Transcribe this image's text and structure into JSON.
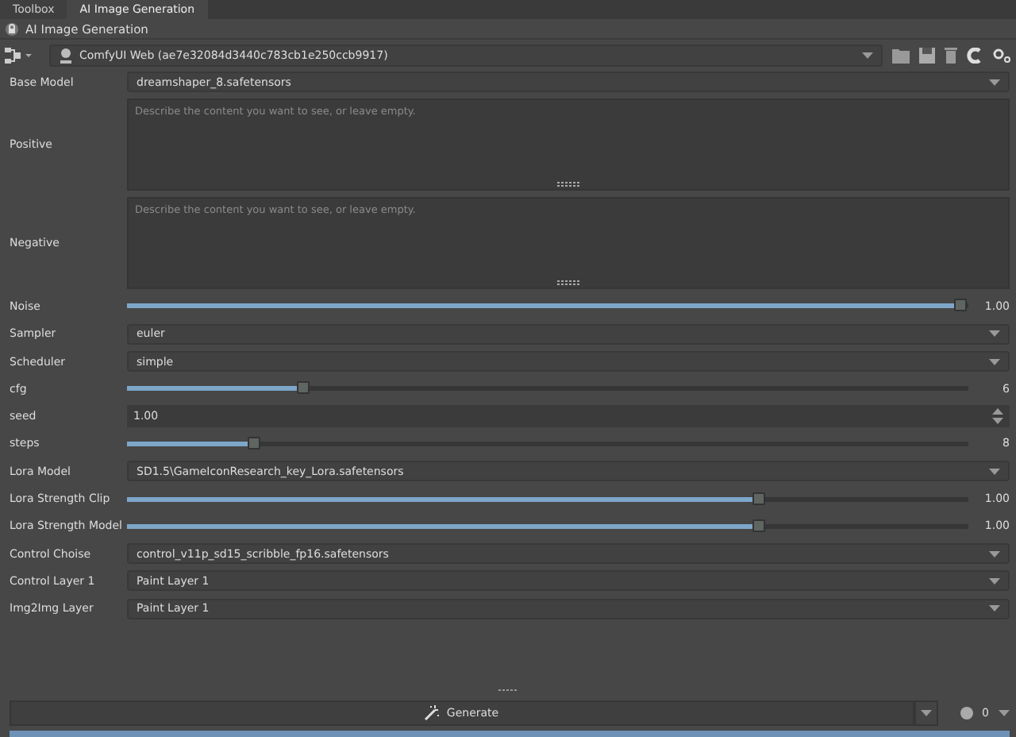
{
  "tabs": [
    {
      "label": "Toolbox",
      "selected": false
    },
    {
      "label": "AI Image Generation",
      "selected": true
    }
  ],
  "panel_title": "AI Image Generation",
  "server": {
    "value": "ComfyUI Web (ae7e32084d3440c783cb1e250ccb9917)"
  },
  "base_model": {
    "label": "Base Model",
    "value": "dreamshaper_8.safetensors"
  },
  "prompts": [
    {
      "label": "Positive",
      "placeholder": "Describe the content you want to see, or leave empty."
    },
    {
      "label": "Negative",
      "placeholder": "Describe the content you want to see, or leave empty."
    }
  ],
  "params": [
    {
      "kind": "slider",
      "label": "Noise",
      "level": 0.99,
      "reading": "1.00"
    },
    {
      "kind": "select",
      "label": "Sampler",
      "value": "euler"
    },
    {
      "kind": "select",
      "label": "Scheduler",
      "value": "simple"
    },
    {
      "kind": "slider",
      "label": "cfg",
      "level": 0.21,
      "reading": "6"
    },
    {
      "kind": "number",
      "label": "seed",
      "value": "1.00"
    },
    {
      "kind": "slider",
      "label": "steps",
      "level": 0.15,
      "reading": "8"
    },
    {
      "kind": "select",
      "label": "Lora Model",
      "value": "SD1.5\\GameIconResearch_key_Lora.safetensors"
    },
    {
      "kind": "slider",
      "label": "Lora Strength Clip",
      "level": 0.75,
      "reading": "1.00"
    },
    {
      "kind": "slider",
      "label": "Lora Strength Model",
      "level": 0.75,
      "reading": "1.00"
    },
    {
      "kind": "select",
      "label": "Control Choise",
      "value": "control_v11p_sd15_scribble_fp16.safetensors"
    },
    {
      "kind": "select",
      "label": "Control Layer 1",
      "value": "Paint Layer 1"
    },
    {
      "kind": "select",
      "label": "Img2Img Layer",
      "value": "Paint Layer 1"
    }
  ],
  "generate": {
    "label": "Generate",
    "count": "0"
  },
  "progress": {
    "level": 1.0
  }
}
